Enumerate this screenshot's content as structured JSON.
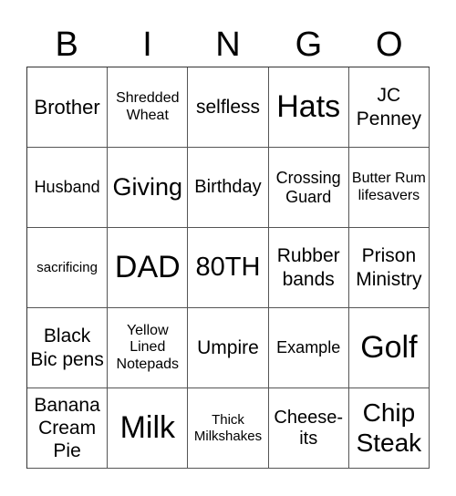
{
  "card": {
    "header": [
      "B",
      "I",
      "N",
      "G",
      "O"
    ],
    "rows": [
      [
        "Brother",
        "Shredded Wheat",
        "selfless",
        "Hats",
        "JC Penney"
      ],
      [
        "Husband",
        "Giving",
        "Birthday",
        "Crossing Guard",
        "Butter Rum lifesavers"
      ],
      [
        "sacrificing",
        "DAD",
        "80TH",
        "Rubber bands",
        "Prison Ministry"
      ],
      [
        "Black Bic pens",
        "Yellow Lined Notepads",
        "Umpire",
        "Example",
        "Golf"
      ],
      [
        "Banana Cream Pie",
        "Milk",
        "Thick Milkshakes",
        "Cheese-its",
        "Chip Steak"
      ]
    ]
  }
}
